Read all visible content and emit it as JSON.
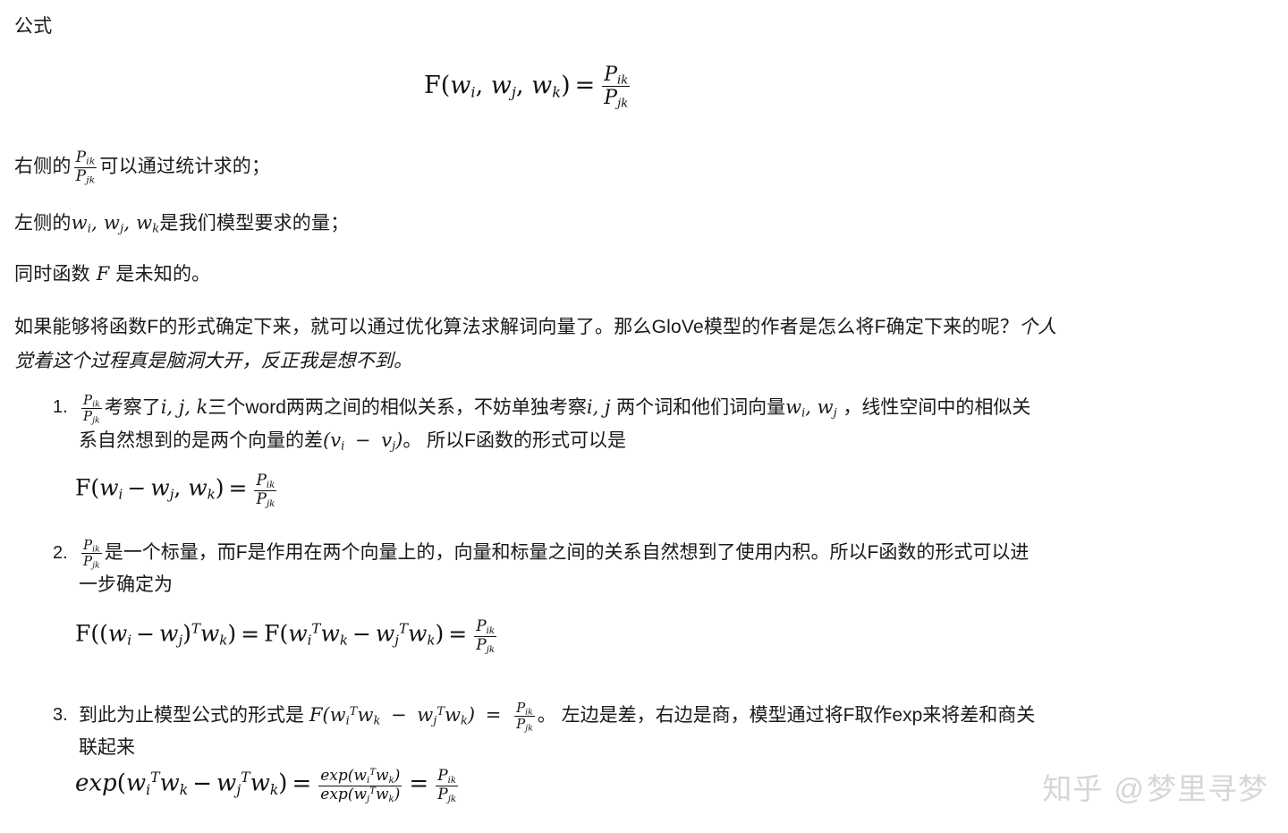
{
  "document": {
    "heading": "公式",
    "main_equation": {
      "lhs": "F(w",
      "sub_i": "i",
      "comma1": ", w",
      "sub_j": "j",
      "comma2": ", w",
      "sub_k": "k",
      "close": ")",
      "equals": "=",
      "numerator_base": "P",
      "numerator_sub": "ik",
      "denominator_base": "P",
      "denominator_sub": "jk"
    },
    "statements": [
      {
        "prefix": "右侧的",
        "fraction": "P_ik / P_jk",
        "suffix": "可以通过统计求的；"
      },
      {
        "prefix": "左侧的",
        "vars": "w_i, w_j, w_k",
        "suffix": "是我们模型要求的量；"
      },
      {
        "prefix": "同时函数",
        "vars": "F",
        "suffix": "是未知的。"
      }
    ],
    "paragraph": {
      "normal_1": "如果能够将函数F的形式确定下来，就可以通过优化算法求解词向量了。那么GloVe模型的作者是怎么将F确定下来的呢？",
      "italic_1": "个人觉着这个过程真是脑洞大开，反正我是想不到。"
    },
    "list": [
      {
        "marker": "1.",
        "text_a": "考察了",
        "vars_a": "i, j, k",
        "text_b": "三个word两两之间的相似关系，不妨单独考察",
        "vars_b": "i, j",
        "text_c": "两个词和他们词向量",
        "vars_c": "w_i, w_j",
        "text_d": "，线性空间中的相似关系自然想到的是两个向量的差",
        "vars_d": "(v_i − v_j)",
        "text_e": "。 所以F函数的形式可以是",
        "equation": "F(w_i − w_j, w_k) = P_ik / P_jk"
      },
      {
        "marker": "2.",
        "text_a": "是一个标量，而F是作用在两个向量上的，向量和标量之间的关系自然想到了使用内积。所以F函数的形式可以进一步确定为",
        "equation": "F((w_i − w_j)^T w_k) = F(w_i^T w_k − w_j^T w_k) = P_ik / P_jk"
      },
      {
        "marker": "3.",
        "text_a": "到此为止模型公式的形式是",
        "inline_equation": "F(w_i^T w_k − w_j^T w_k) = P_ik / P_jk",
        "text_b": "。 左边是差，右边是商，模型通过将F取作exp来将差和商关联起来",
        "equation": "exp(w_i^T w_k − w_j^T w_k) = exp(w_i^T w_k) / exp(w_j^T w_k) = P_ik / P_jk"
      }
    ],
    "watermark": {
      "site": "知乎",
      "at": "@",
      "user": "梦里寻梦"
    },
    "colors": {
      "background": "#ffffff",
      "text": "#1a1a1a",
      "math": "#111111",
      "watermark": "#d4d6d8"
    }
  }
}
